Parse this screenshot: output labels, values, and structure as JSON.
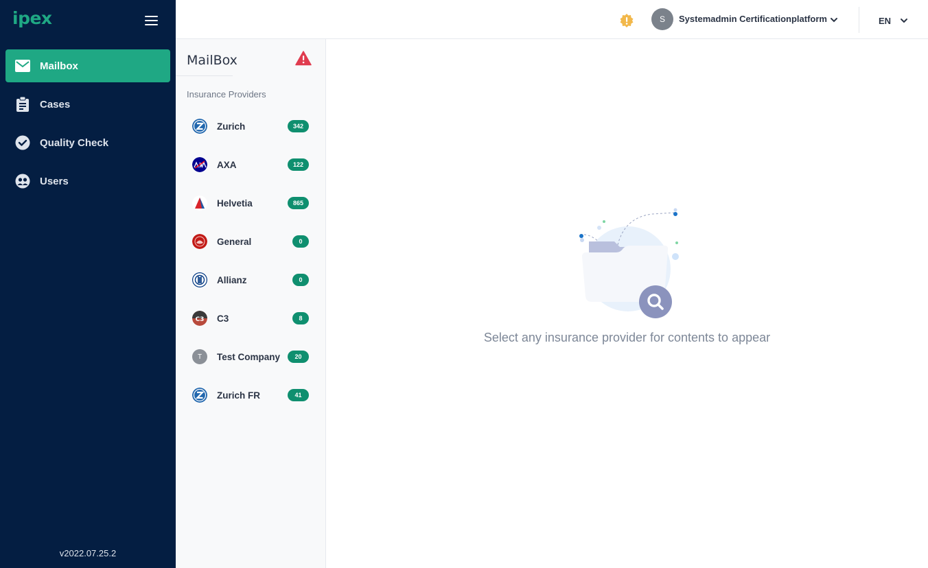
{
  "app": {
    "logo": "ipex",
    "version": "v2022.07.25.2"
  },
  "nav": {
    "items": [
      {
        "label": "Mailbox",
        "icon": "mail-icon",
        "active": true
      },
      {
        "label": "Cases",
        "icon": "clipboard-icon",
        "active": false
      },
      {
        "label": "Quality Check",
        "icon": "check-circle-icon",
        "active": false
      },
      {
        "label": "Users",
        "icon": "users-icon",
        "active": false
      }
    ]
  },
  "header": {
    "user_initial": "S",
    "user_name": "Systemadmin Certificationplatform",
    "language": "EN"
  },
  "mailbox": {
    "title": "MailBox",
    "section_label": "Insurance Providers",
    "providers": [
      {
        "name": "Zurich",
        "count": "342"
      },
      {
        "name": "AXA",
        "count": "122"
      },
      {
        "name": "Helvetia",
        "count": "865"
      },
      {
        "name": "General",
        "count": "0"
      },
      {
        "name": "Allianz",
        "count": "0"
      },
      {
        "name": "C3",
        "count": "8"
      },
      {
        "name": "Test Company",
        "count": "20",
        "logo_initial": "T"
      },
      {
        "name": "Zurich FR",
        "count": "41"
      }
    ]
  },
  "main": {
    "empty_message": "Select any insurance provider for contents to appear"
  },
  "colors": {
    "sidebar_bg": "#041e42",
    "accent": "#1fa884",
    "badge": "#0f8f6f",
    "warning": "#e03c4f",
    "notice": "#f2b84b"
  }
}
